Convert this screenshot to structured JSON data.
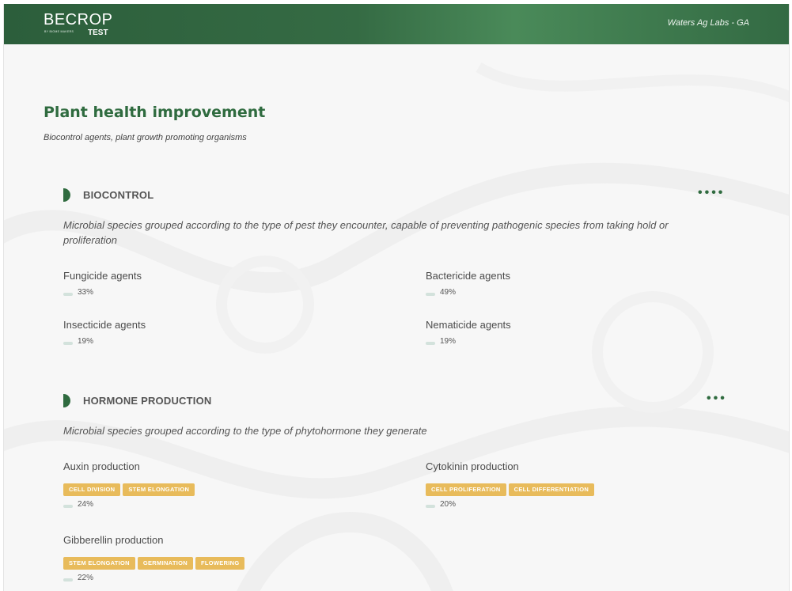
{
  "header": {
    "logo_main": "BECROP",
    "logo_sub": "BY BIOME MAKERS",
    "logo_test": "TEST",
    "lab_name": "Waters Ag Labs - GA"
  },
  "page": {
    "title": "Plant health improvement",
    "subtitle": "Biocontrol agents, plant growth promoting organisms"
  },
  "sections": [
    {
      "title": "BIOCONTROL",
      "menu": "••••",
      "description": "Microbial species grouped according to the type of pest they encounter, capable of preventing pathogenic species from taking hold or proliferation",
      "items": [
        {
          "name": "Fungicide agents",
          "percent": "33%"
        },
        {
          "name": "Bactericide agents",
          "percent": "49%"
        },
        {
          "name": "Insecticide agents",
          "percent": "19%"
        },
        {
          "name": "Nematicide agents",
          "percent": "19%"
        }
      ]
    },
    {
      "title": "HORMONE PRODUCTION",
      "menu": "•••",
      "description": "Microbial species grouped according to the type of phytohormone they generate",
      "items": [
        {
          "name": "Auxin production",
          "tags": [
            "CELL DIVISION",
            "STEM ELONGATION"
          ],
          "percent": "24%"
        },
        {
          "name": "Cytokinin production",
          "tags": [
            "CELL PROLIFERATION",
            "CELL DIFFERENTIATION"
          ],
          "percent": "20%"
        },
        {
          "name": "Gibberellin production",
          "tags": [
            "STEM ELONGATION",
            "GERMINATION",
            "FLOWERING"
          ],
          "percent": "22%"
        }
      ]
    }
  ],
  "colors": {
    "brand_green": "#2f6b3f",
    "tag_yellow": "#e8bb5b",
    "bar": "#d3e2dc"
  }
}
